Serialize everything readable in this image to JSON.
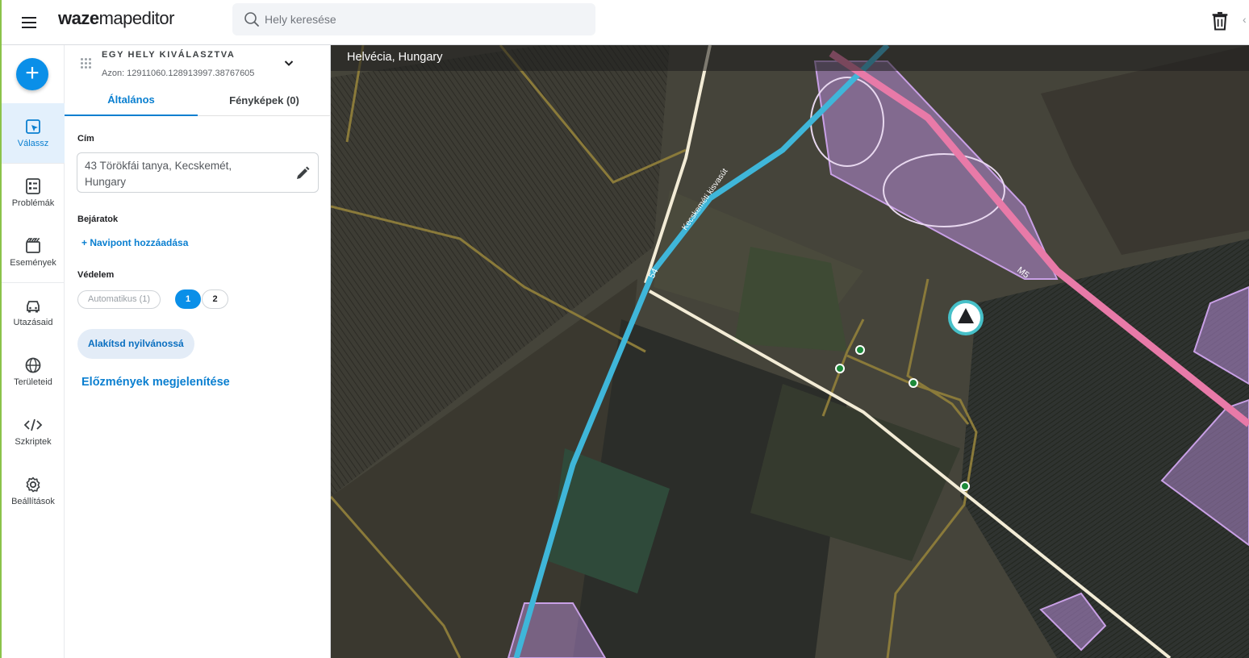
{
  "app": {
    "logo_bold": "waze",
    "logo_rest": "mapeditor",
    "search_placeholder": "Hely keresése"
  },
  "nav": {
    "items": [
      {
        "label": "Válassz",
        "icon": "select-icon"
      },
      {
        "label": "Problémák",
        "icon": "issues-icon"
      },
      {
        "label": "Események",
        "icon": "events-icon"
      },
      {
        "label": "Utazásaid",
        "icon": "car-icon"
      },
      {
        "label": "Területeid",
        "icon": "globe-icon"
      },
      {
        "label": "Szkriptek",
        "icon": "code-icon"
      },
      {
        "label": "Beállítások",
        "icon": "gear-icon"
      }
    ],
    "active": "Válassz",
    "accent": "#0a8fe8"
  },
  "panel": {
    "title": "EGY HELY KIVÁLASZTVA",
    "id_text": "Azon: 12911060.128913997.38767605",
    "tabs": [
      "Általános",
      "Fényképek (0)"
    ],
    "active_tab": "Általános",
    "address_label": "Cím",
    "address_line1": "43 Törökfái tanya, Kecskemét,",
    "address_line2": "Hungary",
    "entrances_label": "Bejáratok",
    "add_navpoint": "+ Navipont hozzáadása",
    "protection_label": "Védelem",
    "protection_auto": "Automatikus (1)",
    "protection_levels": [
      "1",
      "2"
    ],
    "protection_selected": "1",
    "make_public": "Alakítsd nyilvánossá",
    "show_history": "Előzmények megjelenítése"
  },
  "map": {
    "location": "Helvécia, Hungary",
    "road_labels": [
      "M5",
      "54",
      "Kecskeméti kisvasút"
    ],
    "colors": {
      "freeway": "#e87aa8",
      "rail": "#3fb6d9",
      "street": "#f3ecd6",
      "minor_road": "#8a7a3a",
      "place_area": "#b58bd6"
    }
  }
}
